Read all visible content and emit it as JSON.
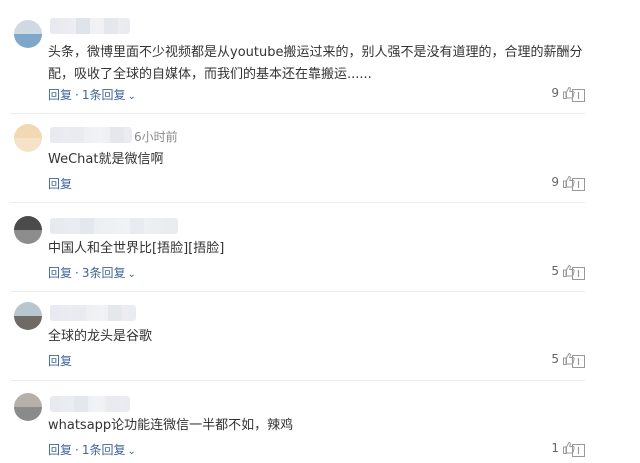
{
  "comments": [
    {
      "time": "",
      "text": "头条，微博里面不少视频都是从youtube搬运过来的，别人强不是没有道理的，合理的薪酬分配，吸收了全球的自媒体，而我们的基本还在靠搬运......",
      "reply_label": "回复",
      "replies_label": "1条回复",
      "likes": "9",
      "avatar_colors": [
        "#cfd8e3",
        "#7ea7c9"
      ]
    },
    {
      "time": "6小时前",
      "text": "WeChat就是微信啊",
      "reply_label": "回复",
      "replies_label": "",
      "likes": "9",
      "avatar_colors": [
        "#f2d9b3",
        "#f4e3c8"
      ]
    },
    {
      "time": "",
      "text": "中国人和全世界比[捂脸][捂脸]",
      "reply_label": "回复",
      "replies_label": "3条回复",
      "likes": "5",
      "avatar_colors": [
        "#4b4b4b",
        "#8d8d8d"
      ]
    },
    {
      "time": "",
      "text": "全球的龙头是谷歌",
      "reply_label": "回复",
      "replies_label": "",
      "likes": "5",
      "avatar_colors": [
        "#b8c6cf",
        "#6f6a64"
      ]
    },
    {
      "time": "",
      "text": "whatsapp论功能连微信一半都不如，辣鸡",
      "reply_label": "回复",
      "replies_label": "1条回复",
      "likes": "1",
      "avatar_colors": [
        "#b6b0a8",
        "#8a8a8a"
      ]
    }
  ],
  "colors": {
    "link": "#406599",
    "text": "#333333",
    "muted": "#8a8a8a",
    "separator": "#ececec"
  },
  "icons": {
    "like": "thumb-up-icon",
    "report": "report-icon",
    "expand": "chevron-down-icon"
  }
}
